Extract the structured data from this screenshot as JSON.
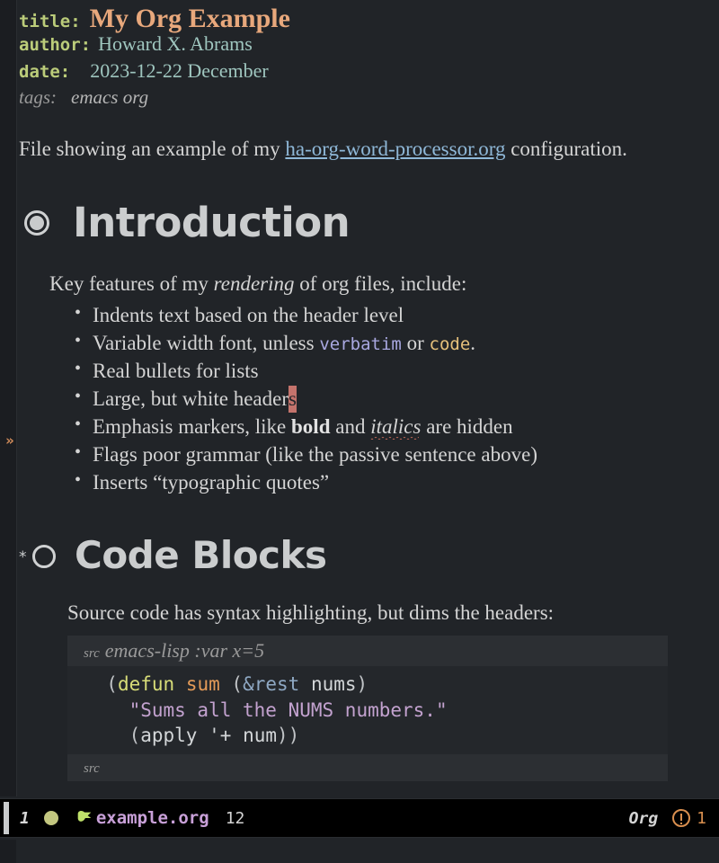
{
  "document": {
    "keywords": [
      {
        "name": "title",
        "label": "title:",
        "value": "My Org Example"
      },
      {
        "name": "author",
        "label": "author:",
        "value": "Howard X. Abrams"
      },
      {
        "name": "date",
        "label": "date:",
        "value": "2023-12-22 December"
      }
    ],
    "tags": {
      "label": "tags:",
      "value": "emacs org"
    },
    "intro": {
      "before_link": "File showing an example of my ",
      "link_text": "ha-org-word-processor.org",
      "after_link": " configuration."
    }
  },
  "sections": [
    {
      "heading": "Introduction",
      "bullet": "filled-ring-bullet",
      "lead": {
        "before_em": "Key features of my ",
        "em": "rendering",
        "after_em": " of org files, include:"
      },
      "items": [
        {
          "text": "Indents text based on the header level"
        },
        {
          "prefix": "Variable width font, unless ",
          "verbatim": "verbatim",
          "mid": " or ",
          "code": "code",
          "suffix": "."
        },
        {
          "text": "Real bullets for lists"
        },
        {
          "prefix": "Large, but white header",
          "cursor": "s",
          "suffix": ""
        },
        {
          "prefix": "Emphasis markers, like ",
          "bold": "bold",
          "mid": " and ",
          "italic": "italics",
          "suffix": " are hidden"
        },
        {
          "text": "Flags poor grammar (like the passive sentence above)"
        },
        {
          "text": "Inserts “typographic quotes”"
        }
      ]
    },
    {
      "heading": "Code Blocks",
      "bullet": "open-ring-bullet",
      "lead_plain": "Source code has syntax highlighting, but dims the headers:",
      "src_block": {
        "begin_keyword": "src",
        "begin_args": "emacs-lisp :var x=5",
        "end_keyword": "src",
        "language": "emacs-lisp",
        "lines": [
          {
            "tokens": [
              {
                "t": "(",
                "c": "paren"
              },
              {
                "t": "defun",
                "c": "keyword"
              },
              {
                "t": " ",
                "c": "plain"
              },
              {
                "t": "sum",
                "c": "fname"
              },
              {
                "t": " ",
                "c": "plain"
              },
              {
                "t": "(",
                "c": "paren"
              },
              {
                "t": "&rest",
                "c": "arg"
              },
              {
                "t": " ",
                "c": "plain"
              },
              {
                "t": "nums",
                "c": "var"
              },
              {
                "t": ")",
                "c": "paren"
              }
            ],
            "indent": "  "
          },
          {
            "tokens": [
              {
                "t": "\"Sums all the NUMS numbers.\"",
                "c": "string"
              }
            ],
            "indent": "    "
          },
          {
            "tokens": [
              {
                "t": "(",
                "c": "paren"
              },
              {
                "t": "apply",
                "c": "var"
              },
              {
                "t": " ",
                "c": "plain"
              },
              {
                "t": "'+",
                "c": "var"
              },
              {
                "t": " ",
                "c": "plain"
              },
              {
                "t": "num",
                "c": "var"
              },
              {
                "t": "))",
                "c": "paren"
              }
            ],
            "indent": "    "
          }
        ]
      }
    }
  ],
  "fringe": {
    "marker": "»"
  },
  "modeline": {
    "window_number": "1",
    "buffer_name": "example.org",
    "line_number": "12",
    "major_mode": "Org",
    "warning_count": "1"
  },
  "colors": {
    "background": "#212428",
    "foreground": "#d4d4d4",
    "title": "#e8a87c",
    "keyword": "#bbcc7a",
    "metadata_value": "#9fc6bf",
    "heading": "#cbcdce",
    "link": "#8fb8d8",
    "verbatim": "#a9a8e0",
    "code": "#e5c07b",
    "cursor": "#c4736c",
    "modeline_bg": "#000000",
    "buffer_name": "#c8a0d8",
    "warning": "#d98f4f",
    "src_header_bg": "#2c2f33",
    "src_body_bg": "#24272b"
  }
}
